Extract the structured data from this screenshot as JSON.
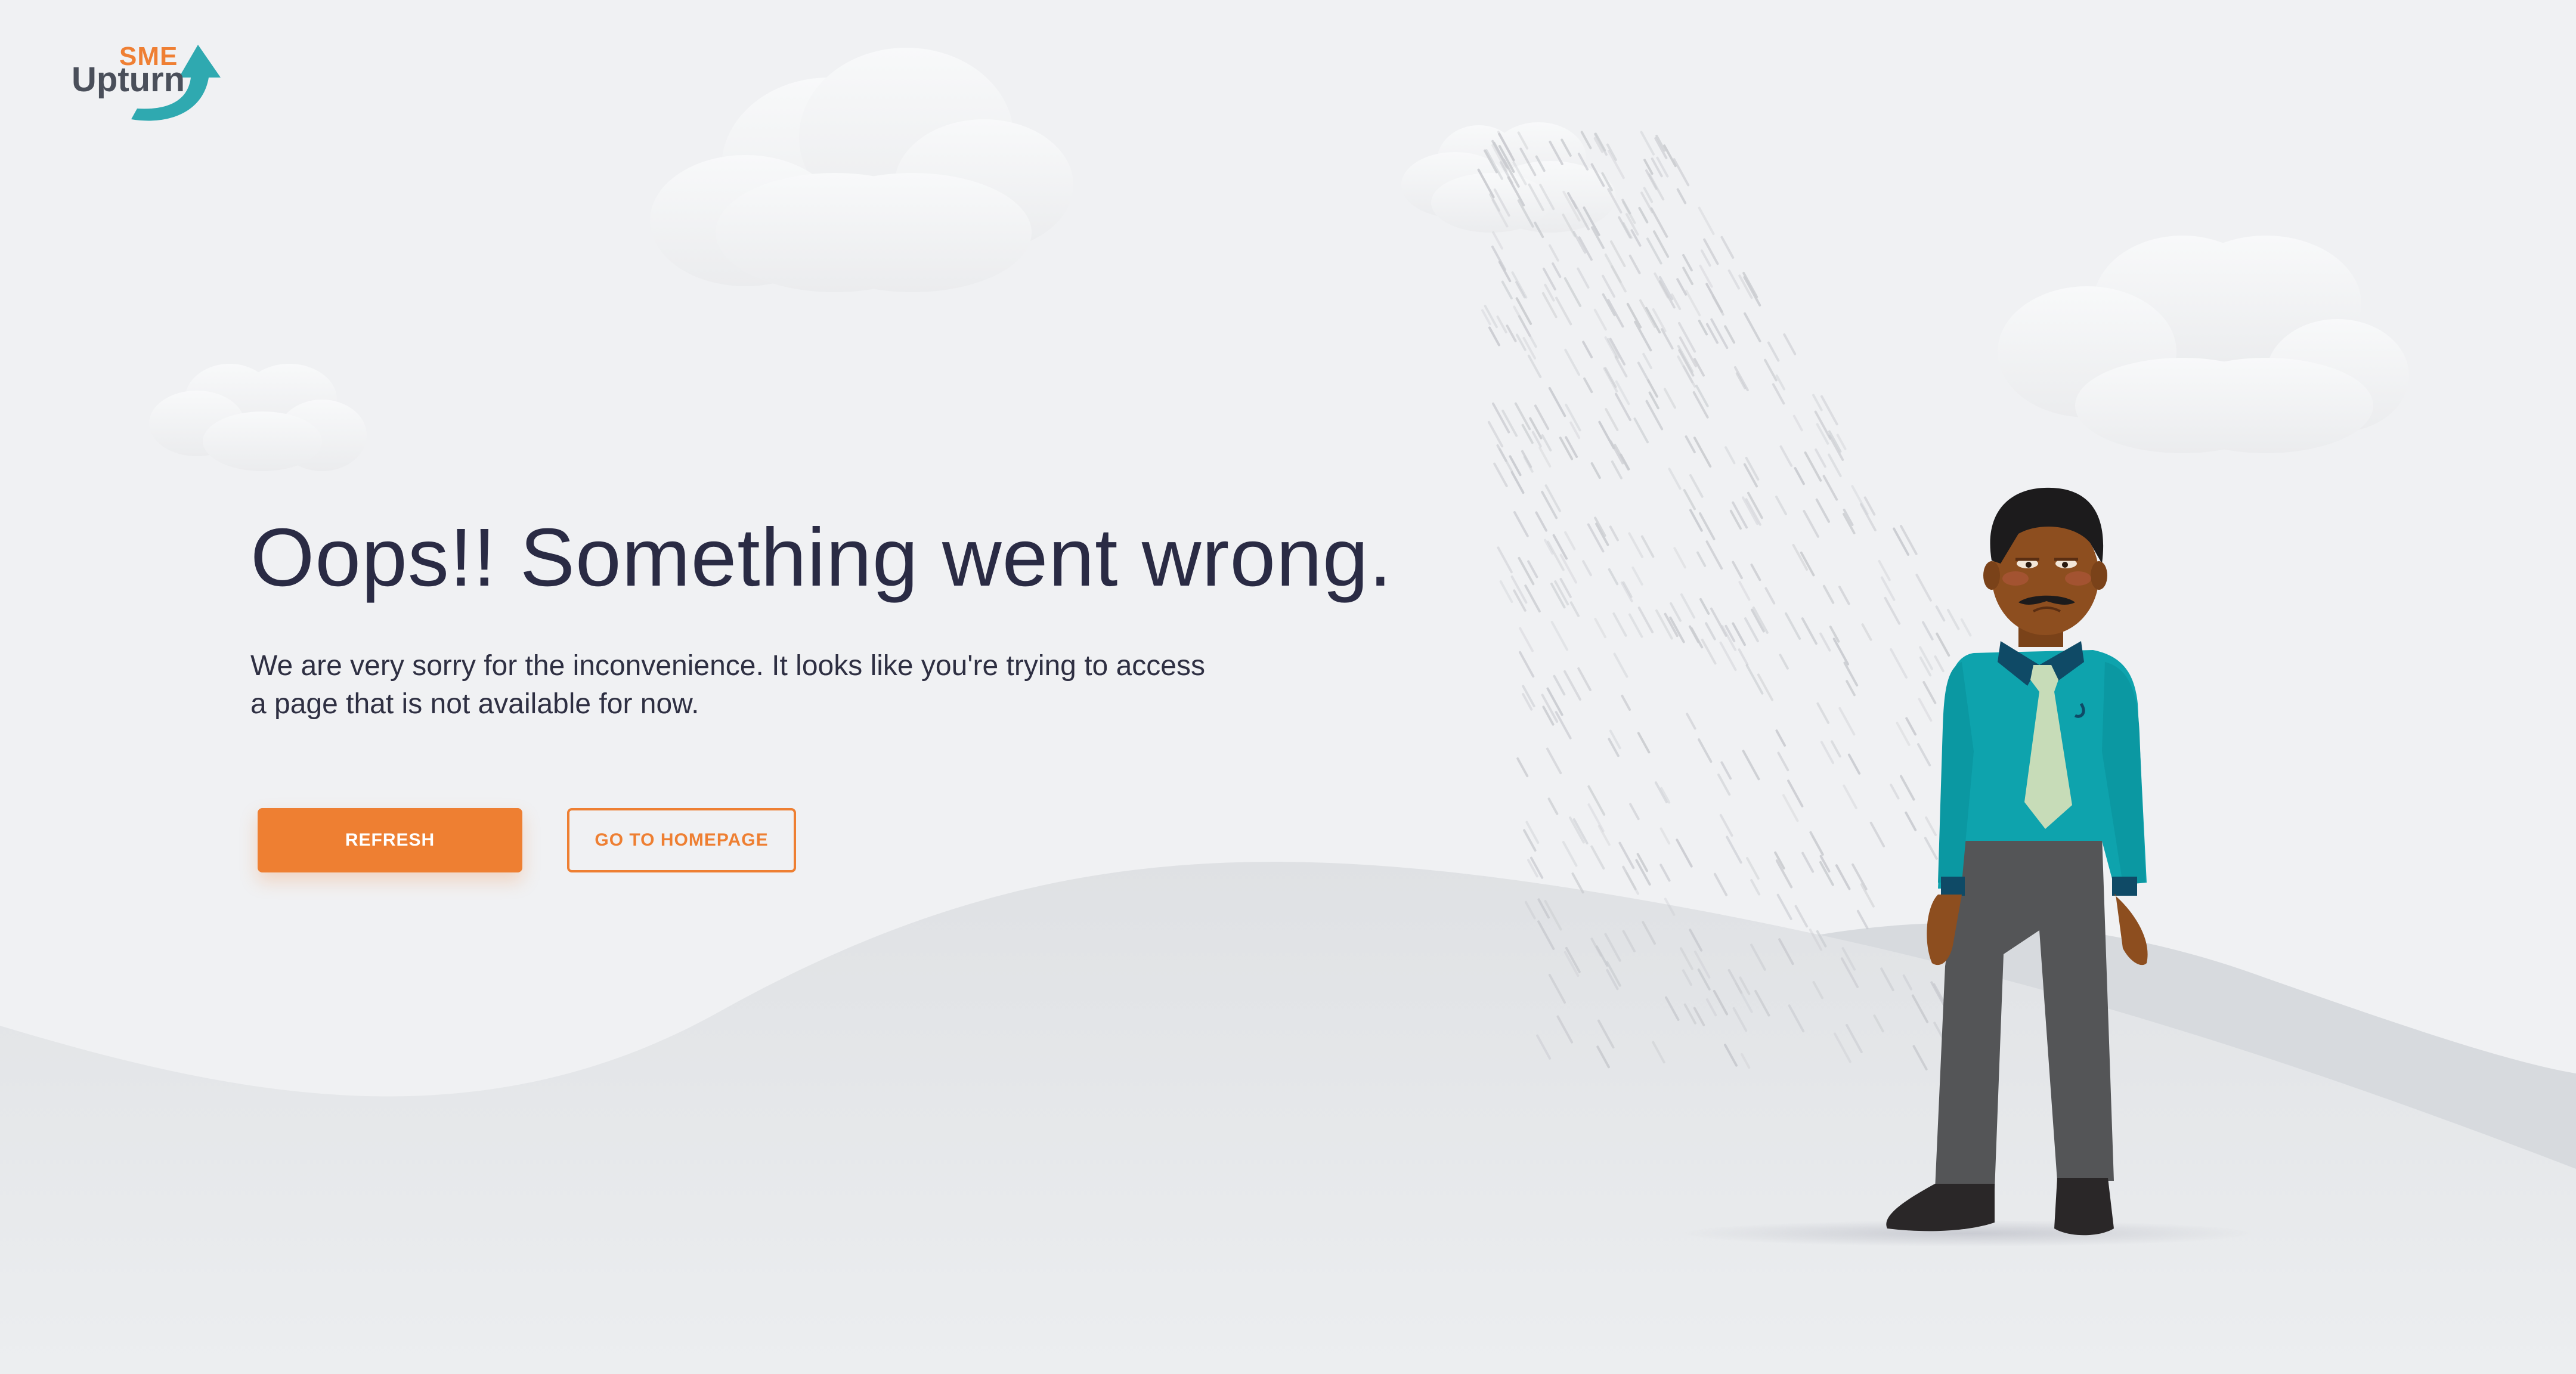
{
  "brand": {
    "logo_top": "SME",
    "logo_bottom": "Upturn",
    "accent_color": "#ee7f32",
    "arrow_color": "#2fa9b0"
  },
  "error": {
    "headline": "Oops!! Something went wrong.",
    "message": "We are very sorry for the inconvenience. It looks like you're trying to access a page that is not available for now."
  },
  "actions": {
    "refresh_label": "REFRESH",
    "homepage_label": "GO TO HOMEPAGE"
  },
  "illustration": {
    "icons": [
      "cloud-icon",
      "rain-icon",
      "sad-man-illustration",
      "hill-shape"
    ]
  }
}
